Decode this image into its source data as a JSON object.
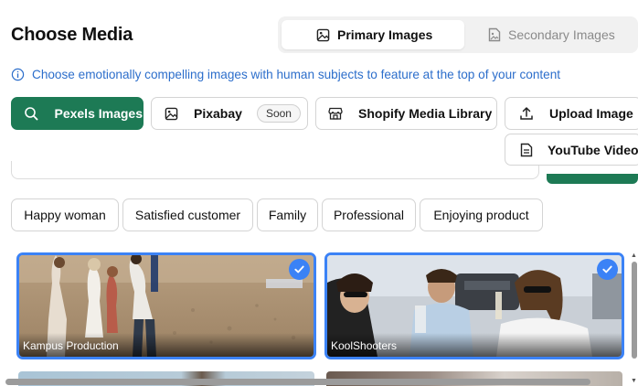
{
  "header": {
    "title": "Choose Media"
  },
  "tabs": [
    {
      "label": "Primary Images",
      "icon": "image-icon",
      "active": true
    },
    {
      "label": "Secondary Images",
      "icon": "image-file-icon",
      "active": false
    }
  ],
  "info": {
    "text": "Choose emotionally compelling images with human subjects to feature at the top of your content",
    "icon": "info-icon",
    "color": "#2c6ecb"
  },
  "sources": [
    {
      "label": "Pexels Images",
      "icon": "search-icon",
      "active": true
    },
    {
      "label": "Pixabay",
      "icon": "image-icon",
      "badge": "Soon"
    },
    {
      "label": "Shopify Media Library",
      "icon": "store-icon"
    },
    {
      "label": "Upload Image",
      "icon": "upload-icon"
    },
    {
      "label": "YouTube Video",
      "icon": "document-icon"
    }
  ],
  "suggestions": [
    "Happy woman",
    "Satisfied customer",
    "Family",
    "Professional",
    "Enjoying product"
  ],
  "results": [
    {
      "credit": "Kampus Production",
      "selected": true
    },
    {
      "credit": "KoolShooters",
      "selected": true
    }
  ],
  "colors": {
    "accent": "#1d7a55",
    "selection": "#3b82f6"
  }
}
